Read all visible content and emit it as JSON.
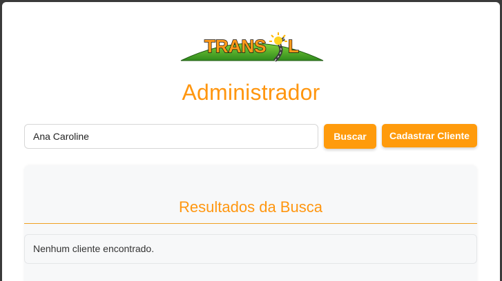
{
  "header": {
    "logo_text": "TRANSOL",
    "title": "Administrador"
  },
  "search": {
    "value": "Ana Caroline",
    "placeholder": ""
  },
  "actions": {
    "search_label": "Buscar",
    "register_label": "Cadastrar Cliente"
  },
  "results": {
    "title": "Resultados da Busca",
    "empty_message": "Nenhum cliente encontrado."
  },
  "colors": {
    "accent": "#ff9b0c",
    "title": "#ff960f",
    "logo_green": "#5cb92e",
    "logo_orange": "#ff9a1a"
  }
}
